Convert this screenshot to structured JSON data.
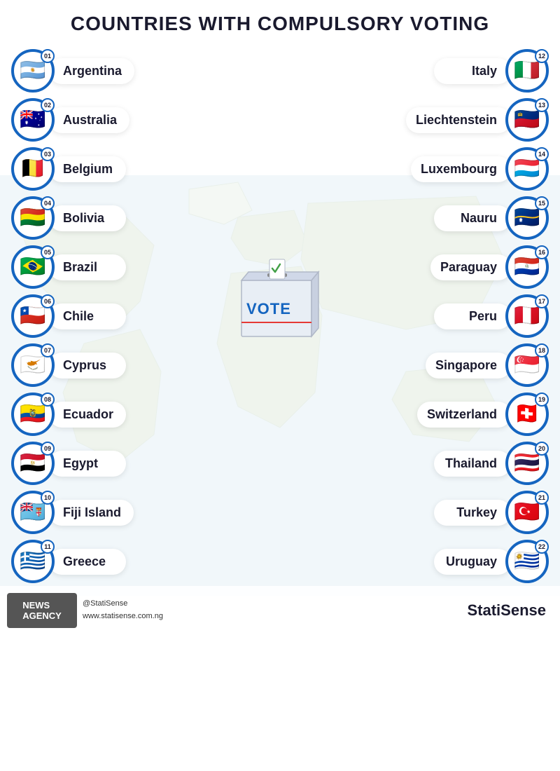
{
  "title": "COUNTRIES WITH COMPULSORY VOTING",
  "left_column": [
    {
      "number": "01",
      "name": "Argentina",
      "flag": "🇦🇷"
    },
    {
      "number": "02",
      "name": "Australia",
      "flag": "🇦🇺"
    },
    {
      "number": "03",
      "name": "Belgium",
      "flag": "🇧🇪"
    },
    {
      "number": "04",
      "name": "Bolivia",
      "flag": "🇧🇴"
    },
    {
      "number": "05",
      "name": "Brazil",
      "flag": "🇧🇷"
    },
    {
      "number": "06",
      "name": "Chile",
      "flag": "🇨🇱"
    },
    {
      "number": "07",
      "name": "Cyprus",
      "flag": "🇨🇾"
    },
    {
      "number": "08",
      "name": "Ecuador",
      "flag": "🇪🇨"
    },
    {
      "number": "09",
      "name": "Egypt",
      "flag": "🇪🇬"
    },
    {
      "number": "10",
      "name": "Fiji Island",
      "flag": "🇫🇯"
    },
    {
      "number": "11",
      "name": "Greece",
      "flag": "🇬🇷"
    }
  ],
  "right_column": [
    {
      "number": "12",
      "name": "Italy",
      "flag": "🇮🇹"
    },
    {
      "number": "13",
      "name": "Liechtenstein",
      "flag": "🇱🇮"
    },
    {
      "number": "14",
      "name": "Luxembourg",
      "flag": "🇱🇺"
    },
    {
      "number": "15",
      "name": "Nauru",
      "flag": "🇳🇷"
    },
    {
      "number": "16",
      "name": "Paraguay",
      "flag": "🇵🇾"
    },
    {
      "number": "17",
      "name": "Peru",
      "flag": "🇵🇪"
    },
    {
      "number": "18",
      "name": "Singapore",
      "flag": "🇸🇬"
    },
    {
      "number": "19",
      "name": "Switzerland",
      "flag": "🇨🇭"
    },
    {
      "number": "20",
      "name": "Thailand",
      "flag": "🇹🇭"
    },
    {
      "number": "21",
      "name": "Turkey",
      "flag": "🇹🇷"
    },
    {
      "number": "22",
      "name": "Uruguay",
      "flag": "🇺🇾"
    }
  ],
  "footer": {
    "social_handle": "@StatiSense",
    "website": "www.statisense.com.ng",
    "brand": "StatiSense"
  }
}
